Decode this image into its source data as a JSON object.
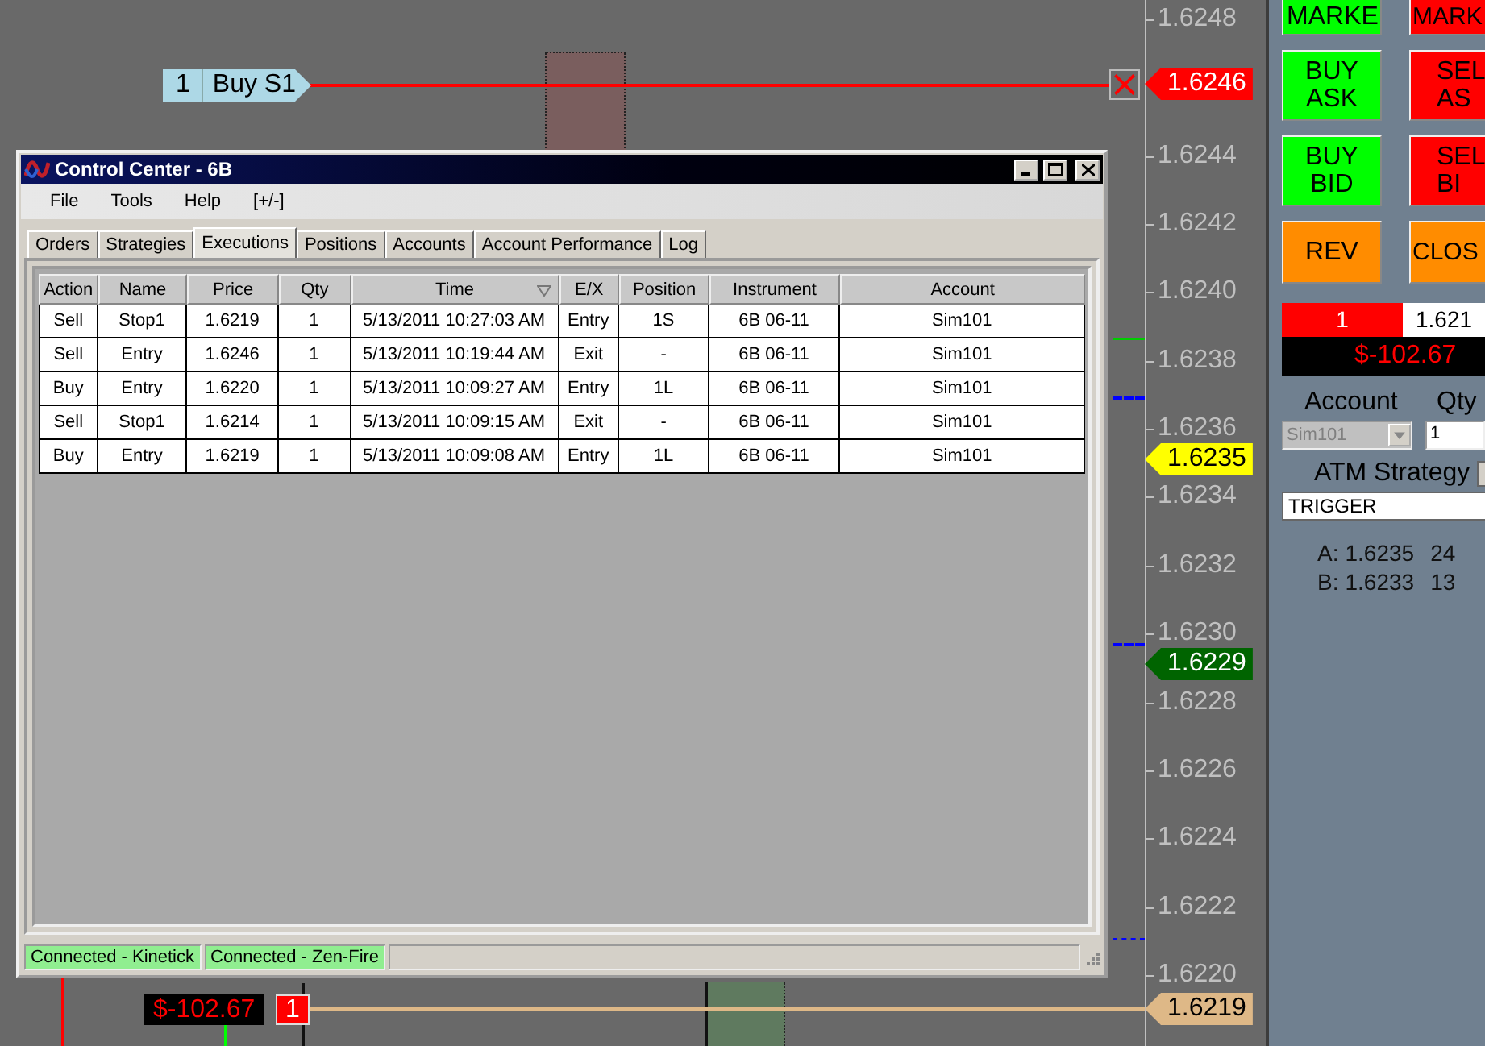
{
  "chart": {
    "axis_labels": [
      "1.6248",
      "1.6244",
      "1.6242",
      "1.6240",
      "1.6238",
      "1.6236",
      "1.6234",
      "1.6232",
      "1.6230",
      "1.6228",
      "1.6226",
      "1.6224",
      "1.6222",
      "1.6220"
    ],
    "price_tags": [
      {
        "label": "1.6246",
        "color": "#ff0000"
      },
      {
        "label": "1.6235",
        "color": "#ffff00"
      },
      {
        "label": "1.6229",
        "color": "#006400"
      },
      {
        "label": "1.6219",
        "color": "#deb887"
      }
    ],
    "order": {
      "qty": "1",
      "label": "Buy S1"
    },
    "position": {
      "pnl": "$-102.67",
      "qty": "1"
    }
  },
  "window": {
    "title": "Control Center - 6B",
    "menu": [
      "File",
      "Tools",
      "Help",
      "[+/-]"
    ],
    "tabs": [
      {
        "label": "Orders",
        "selected": false
      },
      {
        "label": "Strategies",
        "selected": false
      },
      {
        "label": "Executions",
        "selected": true
      },
      {
        "label": "Positions",
        "selected": false
      },
      {
        "label": "Accounts",
        "selected": false
      },
      {
        "label": "Account Performance",
        "selected": false
      },
      {
        "label": "Log",
        "selected": false
      }
    ],
    "table": {
      "columns": [
        "Action",
        "Name",
        "Price",
        "Qty",
        "Time",
        "E/X",
        "Position",
        "Instrument",
        "Account"
      ],
      "rows": [
        [
          "Sell",
          "Stop1",
          "1.6219",
          "1",
          "5/13/2011 10:27:03 AM",
          "Entry",
          "1S",
          "6B 06-11",
          "Sim101"
        ],
        [
          "Sell",
          "Entry",
          "1.6246",
          "1",
          "5/13/2011 10:19:44 AM",
          "Exit",
          "-",
          "6B 06-11",
          "Sim101"
        ],
        [
          "Buy",
          "Entry",
          "1.6220",
          "1",
          "5/13/2011 10:09:27 AM",
          "Entry",
          "1L",
          "6B 06-11",
          "Sim101"
        ],
        [
          "Sell",
          "Stop1",
          "1.6214",
          "1",
          "5/13/2011 10:09:15 AM",
          "Exit",
          "-",
          "6B 06-11",
          "Sim101"
        ],
        [
          "Buy",
          "Entry",
          "1.6219",
          "1",
          "5/13/2011 10:09:08 AM",
          "Entry",
          "1L",
          "6B 06-11",
          "Sim101"
        ]
      ]
    },
    "status_bar": [
      "Connected - Kinetick",
      "Connected - Zen-Fire"
    ]
  },
  "panel": {
    "buttons": [
      {
        "lines": [
          "MARKE"
        ],
        "color": "#00ff00"
      },
      {
        "lines": [
          "MARK"
        ],
        "color": "#ff0000"
      },
      {
        "lines": [
          "BUY",
          "ASK"
        ],
        "color": "#00ff00"
      },
      {
        "lines": [
          "SEL",
          "AS"
        ],
        "color": "#ff0000"
      },
      {
        "lines": [
          "BUY",
          "BID"
        ],
        "color": "#00ff00"
      },
      {
        "lines": [
          "SEL",
          "BI"
        ],
        "color": "#ff0000"
      },
      {
        "lines": [
          "REV"
        ],
        "color": "#ff8c00"
      },
      {
        "lines": [
          "CLOS"
        ],
        "color": "#ff8c00"
      }
    ],
    "position": {
      "qty": "1",
      "price": "1.621",
      "pnl": "$-102.67"
    },
    "account_label": "Account",
    "qty_label": "Qty",
    "account": {
      "value": "Sim101",
      "disabled": true
    },
    "qty": {
      "value": "1"
    },
    "atm_label": "ATM Strategy",
    "atm": {
      "value": "TRIGGER"
    },
    "quotes": [
      {
        "side": "A:",
        "price": "1.6235",
        "size": "24"
      },
      {
        "side": "B:",
        "price": "1.6233",
        "size": "13"
      }
    ]
  }
}
